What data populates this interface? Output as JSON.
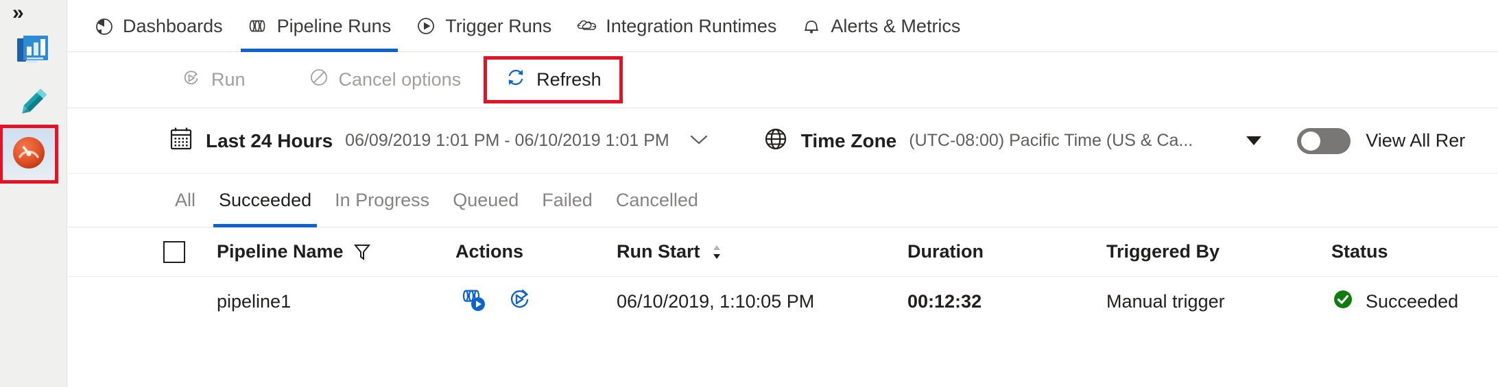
{
  "rail": {
    "expand_glyph": "»",
    "items": [
      {
        "name": "data-factory-overview",
        "icon": "factory-overview-icon"
      },
      {
        "name": "author-pencil",
        "icon": "pencil-icon"
      },
      {
        "name": "monitor-gauge",
        "icon": "monitor-gauge-icon",
        "selected": true,
        "highlight_color": "#e81123"
      }
    ]
  },
  "topnav": {
    "tabs": [
      {
        "label": "Dashboards",
        "icon": "pie-chart-icon",
        "active": false
      },
      {
        "label": "Pipeline Runs",
        "icon": "pipeline-icon",
        "active": true
      },
      {
        "label": "Trigger Runs",
        "icon": "play-circle-icon",
        "active": false
      },
      {
        "label": "Integration Runtimes",
        "icon": "integration-runtime-icon",
        "active": false
      },
      {
        "label": "Alerts & Metrics",
        "icon": "bell-icon",
        "active": false
      }
    ],
    "active_underline_color": "#0b63ce"
  },
  "commandbar": {
    "run_label": "Run",
    "run_icon": "run-icon",
    "run_enabled": false,
    "cancel_label": "Cancel options",
    "cancel_icon": "cancel-circle-icon",
    "cancel_enabled": false,
    "refresh_label": "Refresh",
    "refresh_icon": "refresh-icon",
    "refresh_enabled": true,
    "refresh_highlight_color": "#e81123",
    "refresh_icon_color": "#0b63ce"
  },
  "filterbar": {
    "calendar_icon": "calendar-icon",
    "range_label": "Last 24 Hours",
    "range_value": "06/09/2019 1:01 PM - 06/10/2019 1:01 PM",
    "range_caret": "⌄",
    "globe_icon": "globe-icon",
    "timezone_label": "Time Zone",
    "timezone_value": "(UTC-08:00) Pacific Time (US & Ca...",
    "dropdown_icon": "chevron-down-icon",
    "toggle_label": "View All Rer",
    "toggle_on": false,
    "toggle_off_color": "#797775"
  },
  "statusfilters": {
    "tabs": [
      {
        "label": "All",
        "active": false
      },
      {
        "label": "Succeeded",
        "active": true
      },
      {
        "label": "In Progress",
        "active": false
      },
      {
        "label": "Queued",
        "active": false
      },
      {
        "label": "Failed",
        "active": false
      },
      {
        "label": "Cancelled",
        "active": false
      }
    ]
  },
  "table": {
    "select_all_checked": false,
    "columns": {
      "pipeline_name": "Pipeline Name",
      "actions": "Actions",
      "run_start": "Run Start",
      "duration": "Duration",
      "triggered_by": "Triggered By",
      "status": "Status"
    },
    "name_filter_icon": "filter-funnel-icon",
    "run_start_sort_icon": "sort-arrows-icon",
    "rows": [
      {
        "checked": false,
        "pipeline_name": "pipeline1",
        "actions": [
          "view-pipeline-run-icon",
          "rerun-icon"
        ],
        "run_start": "06/10/2019, 1:10:05 PM",
        "duration": "00:12:32",
        "triggered_by": "Manual trigger",
        "status": "Succeeded",
        "status_icon": "success-check-icon",
        "status_color": "#107c10"
      }
    ]
  }
}
